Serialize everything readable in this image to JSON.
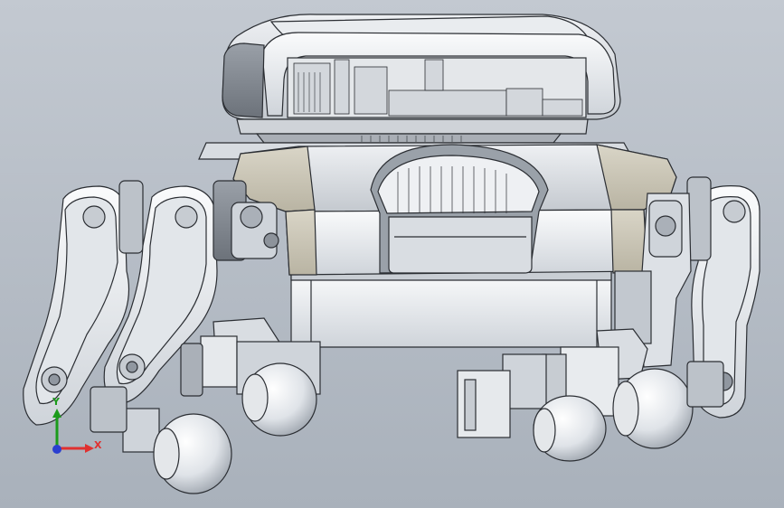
{
  "viewport": {
    "background_top": "#c3c9d1",
    "background_bottom": "#a9b1bb",
    "model_shade_light": "#f2f3f5",
    "model_shade_mid": "#d7dbe0",
    "model_shade_dark": "#8d939b",
    "tan_panel_color": "#c9c4b4",
    "outline_color": "#2b2e33"
  },
  "triad": {
    "x_label": "X",
    "y_label": "Y",
    "x_color": "#e03030",
    "y_color": "#1b9b1b",
    "z_color": "#2a3fd0",
    "icon": "coordinate-triad-icon"
  }
}
